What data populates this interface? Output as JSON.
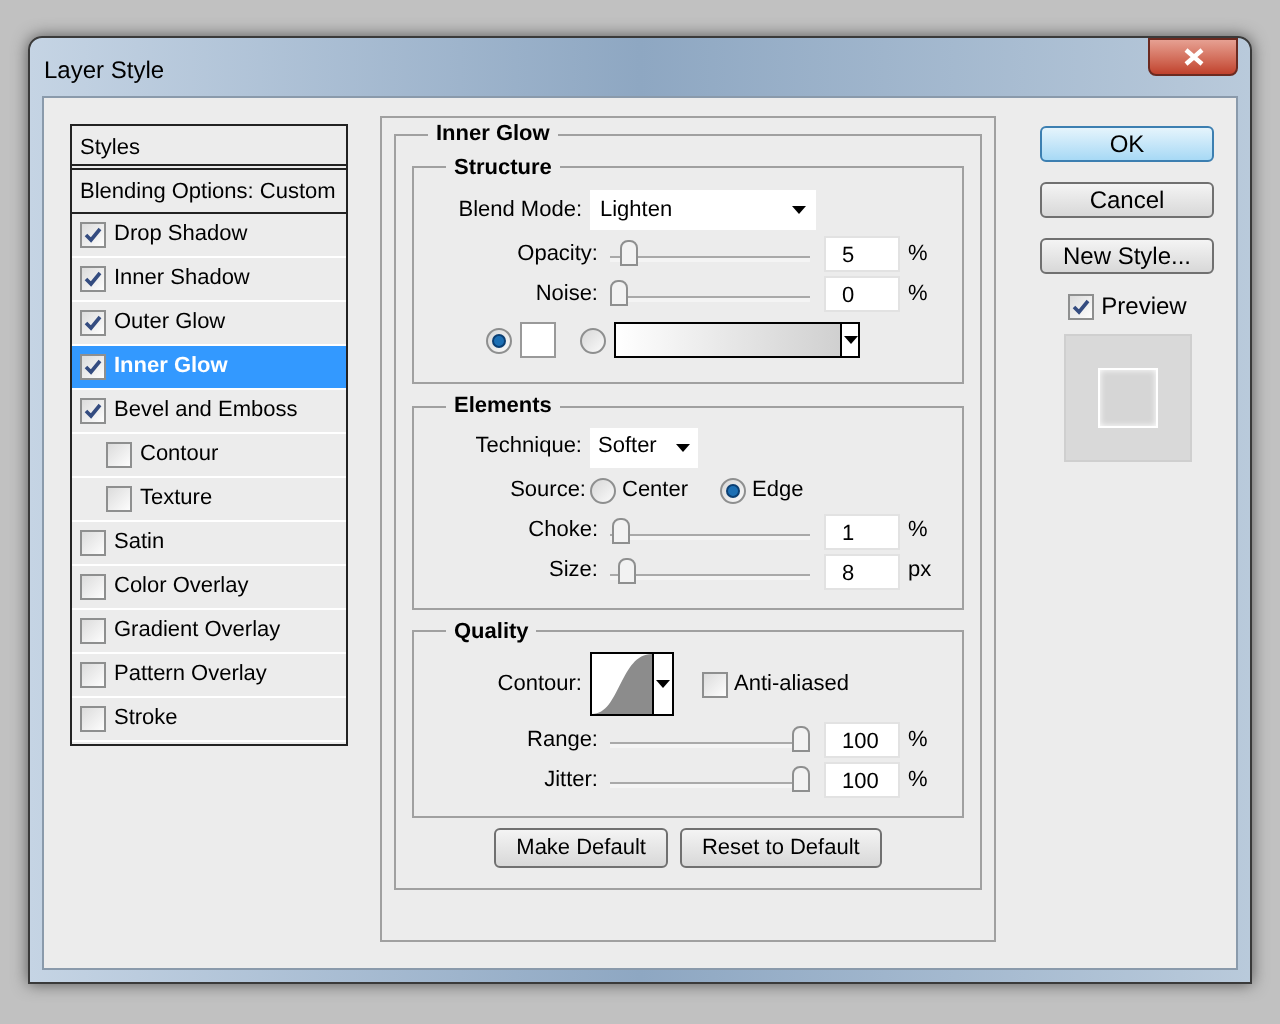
{
  "window": {
    "title": "Layer Style"
  },
  "styles_list": {
    "header": "Styles",
    "items": [
      {
        "kind": "heading",
        "label": "Blending Options: Custom",
        "selected": false
      },
      {
        "kind": "check",
        "label": "Drop Shadow",
        "checked": true,
        "selected": false
      },
      {
        "kind": "check",
        "label": "Inner Shadow",
        "checked": true,
        "selected": false
      },
      {
        "kind": "check",
        "label": "Outer Glow",
        "checked": true,
        "selected": false
      },
      {
        "kind": "check",
        "label": "Inner Glow",
        "checked": true,
        "selected": true
      },
      {
        "kind": "check",
        "label": "Bevel and Emboss",
        "checked": true,
        "selected": false,
        "children": [
          {
            "kind": "check",
            "label": "Contour",
            "checked": false,
            "selected": false
          },
          {
            "kind": "check",
            "label": "Texture",
            "checked": false,
            "selected": false
          }
        ]
      },
      {
        "kind": "check",
        "label": "Satin",
        "checked": false,
        "selected": false
      },
      {
        "kind": "check",
        "label": "Color Overlay",
        "checked": false,
        "selected": false
      },
      {
        "kind": "check",
        "label": "Gradient Overlay",
        "checked": false,
        "selected": false
      },
      {
        "kind": "check",
        "label": "Pattern Overlay",
        "checked": false,
        "selected": false
      },
      {
        "kind": "check",
        "label": "Stroke",
        "checked": false,
        "selected": false
      }
    ]
  },
  "panel": {
    "title": "Inner Glow",
    "structure": {
      "title": "Structure",
      "blend_mode": {
        "label": "Blend Mode:",
        "value": "Lighten"
      },
      "sliders": [
        {
          "label": "Opacity:",
          "level": 0.05,
          "value": "5",
          "unit": "%"
        },
        {
          "label": "Noise:",
          "level": 0,
          "value": "0",
          "unit": "%"
        }
      ],
      "fill": [
        {
          "kind": "color",
          "selected": true
        },
        {
          "kind": "gradient",
          "selected": false
        }
      ]
    },
    "elements": {
      "title": "Elements",
      "technique": {
        "label": "Technique:",
        "value": "Softer"
      },
      "source": {
        "label": "Source:",
        "options": [
          {
            "label": "Center",
            "selected": false
          },
          {
            "label": "Edge",
            "selected": true
          }
        ]
      },
      "sliders": [
        {
          "label": "Choke:",
          "level": 0.01,
          "value": "1",
          "unit": "%"
        },
        {
          "label": "Size:",
          "level": 0.04,
          "value": "8",
          "unit": "px"
        }
      ]
    },
    "quality": {
      "title": "Quality",
      "contour_label": "Contour:",
      "anti_aliased": {
        "label": "Anti-aliased",
        "checked": false
      },
      "sliders": [
        {
          "label": "Range:",
          "level": 1,
          "value": "100",
          "unit": "%"
        },
        {
          "label": "Jitter:",
          "level": 1,
          "value": "100",
          "unit": "%"
        }
      ]
    },
    "buttons": [
      "Make Default",
      "Reset to Default"
    ]
  },
  "actions": {
    "buttons": [
      {
        "label": "OK",
        "default": true
      },
      {
        "label": "Cancel",
        "default": false
      },
      {
        "label": "New Style...",
        "default": false
      }
    ],
    "preview": {
      "label": "Preview",
      "checked": true
    }
  }
}
